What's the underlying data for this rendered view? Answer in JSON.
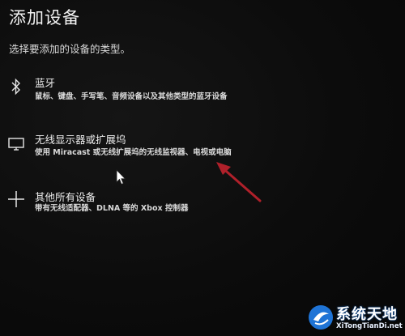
{
  "dialog": {
    "title": "添加设备",
    "subtitle": "选择要添加的设备的类型。"
  },
  "options": [
    {
      "icon": "bluetooth-icon",
      "label": "蓝牙",
      "description": "鼠标、键盘、手写笔、音频设备以及其他类型的蓝牙设备"
    },
    {
      "icon": "monitor-icon",
      "label": "无线显示器或扩展坞",
      "description": "使用 Miracast 或无线扩展坞的无线监视器、电视或电脑"
    },
    {
      "icon": "plus-icon",
      "label": "其他所有设备",
      "description": "带有无线适配器、DLNA 等的 Xbox 控制器"
    }
  ],
  "annotation": {
    "arrow_color": "#b0202a"
  },
  "watermark": {
    "title": "系统天地",
    "url": "XiTongTianDi.net"
  }
}
